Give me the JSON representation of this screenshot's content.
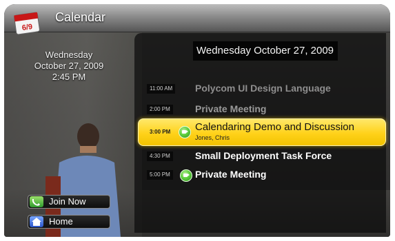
{
  "app": {
    "title": "Calendar",
    "icon": "calendar-icon",
    "icon_text": "6/9"
  },
  "datetime": {
    "weekday": "Wednesday",
    "date": "October 27, 2009",
    "time": "2:45 PM"
  },
  "panel": {
    "header": "Wednesday October 27, 2009"
  },
  "meetings": [
    {
      "time": "11:00 AM",
      "title": "Polycom UI Design Language",
      "video": false,
      "state": "past"
    },
    {
      "time": "2:00 PM",
      "title": "Private Meeting",
      "video": false,
      "state": "past"
    },
    {
      "time": "3:00 PM",
      "title": "Calendaring Demo and Discussion",
      "organizer": "Jones, Chris",
      "video": true,
      "state": "selected"
    },
    {
      "time": "4:30 PM",
      "title": "Small Deployment Task Force",
      "video": false,
      "state": "upcoming"
    },
    {
      "time": "5:00 PM",
      "title": "Private Meeting",
      "video": true,
      "state": "upcoming"
    }
  ],
  "buttons": {
    "join": {
      "label": "Join Now",
      "icon": "phone-icon"
    },
    "home": {
      "label": "Home",
      "icon": "house-icon"
    }
  },
  "colors": {
    "highlight": "#ffd21a",
    "video_icon": "#5fcf3f"
  }
}
